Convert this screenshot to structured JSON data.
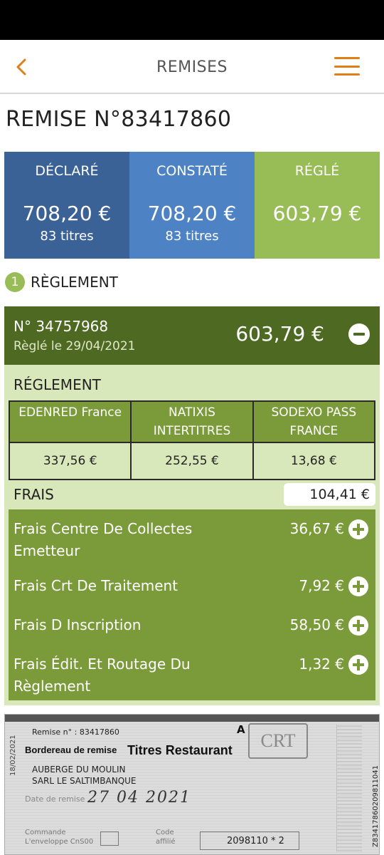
{
  "header": {
    "title": "REMISES",
    "back_icon": "chevron-left-icon",
    "menu_icon": "hamburger-menu-icon",
    "accent_color": "#e07f17"
  },
  "page": {
    "title": "REMISE N°83417860"
  },
  "summary": {
    "declared": {
      "label": "DÉCLARÉ",
      "amount": "708,20 €",
      "count": "83 titres",
      "color": "#3a6297"
    },
    "observed": {
      "label": "CONSTATÉ",
      "amount": "708,20 €",
      "count": "83 titres",
      "color": "#4d82c4"
    },
    "settled": {
      "label": "RÉGLÉ",
      "amount": "603,79 €",
      "color": "#98bc56"
    }
  },
  "section": {
    "number": "1",
    "title": "RÈGLEMENT"
  },
  "payment": {
    "number": "N° 34757968",
    "date": "Règlé le 29/04/2021",
    "amount": "603,79 €",
    "collapse_icon": "minus-circle-icon",
    "breakdown_title": "RÉGLEMENT",
    "issuers": [
      {
        "name": "EDENRED France",
        "amount": "337,56 €"
      },
      {
        "name": "NATIXIS INTERTITRES",
        "amount": "252,55 €"
      },
      {
        "name": "SODEXO PASS FRANCE",
        "amount": "13,68 €"
      }
    ],
    "fees_label": "FRAIS",
    "fees_total": "104,41 €",
    "fees": [
      {
        "label": "Frais Centre De Collectes Emetteur",
        "amount": "36,67 €"
      },
      {
        "label": "Frais Crt De Traitement",
        "amount": "7,92 €"
      },
      {
        "label": "Frais D Inscription",
        "amount": "58,50 €"
      },
      {
        "label": "Frais Édit. Et Routage Du Règlement",
        "amount": "1,32 €"
      }
    ]
  },
  "document": {
    "remise_line": "Remise n° : 83417860",
    "bordereau": "Bordereau de remise",
    "titres": "Titres Restaurant",
    "a_label": "A",
    "logo": "CRT",
    "company1": "AUBERGE DU MOULIN",
    "company2": "SARL LE SALTIMBANQUE",
    "date_label": "Date de remise",
    "handwritten_date": "27 04 2021",
    "commande_label": "Commande",
    "envelopes_label": "L'enveloppe CnS00",
    "code_label": "Code",
    "affilie_label": "affilié",
    "code_value": "2098110 * 2",
    "side_code": "18/02/2021",
    "barcode_number": "Z83417860209811041"
  }
}
